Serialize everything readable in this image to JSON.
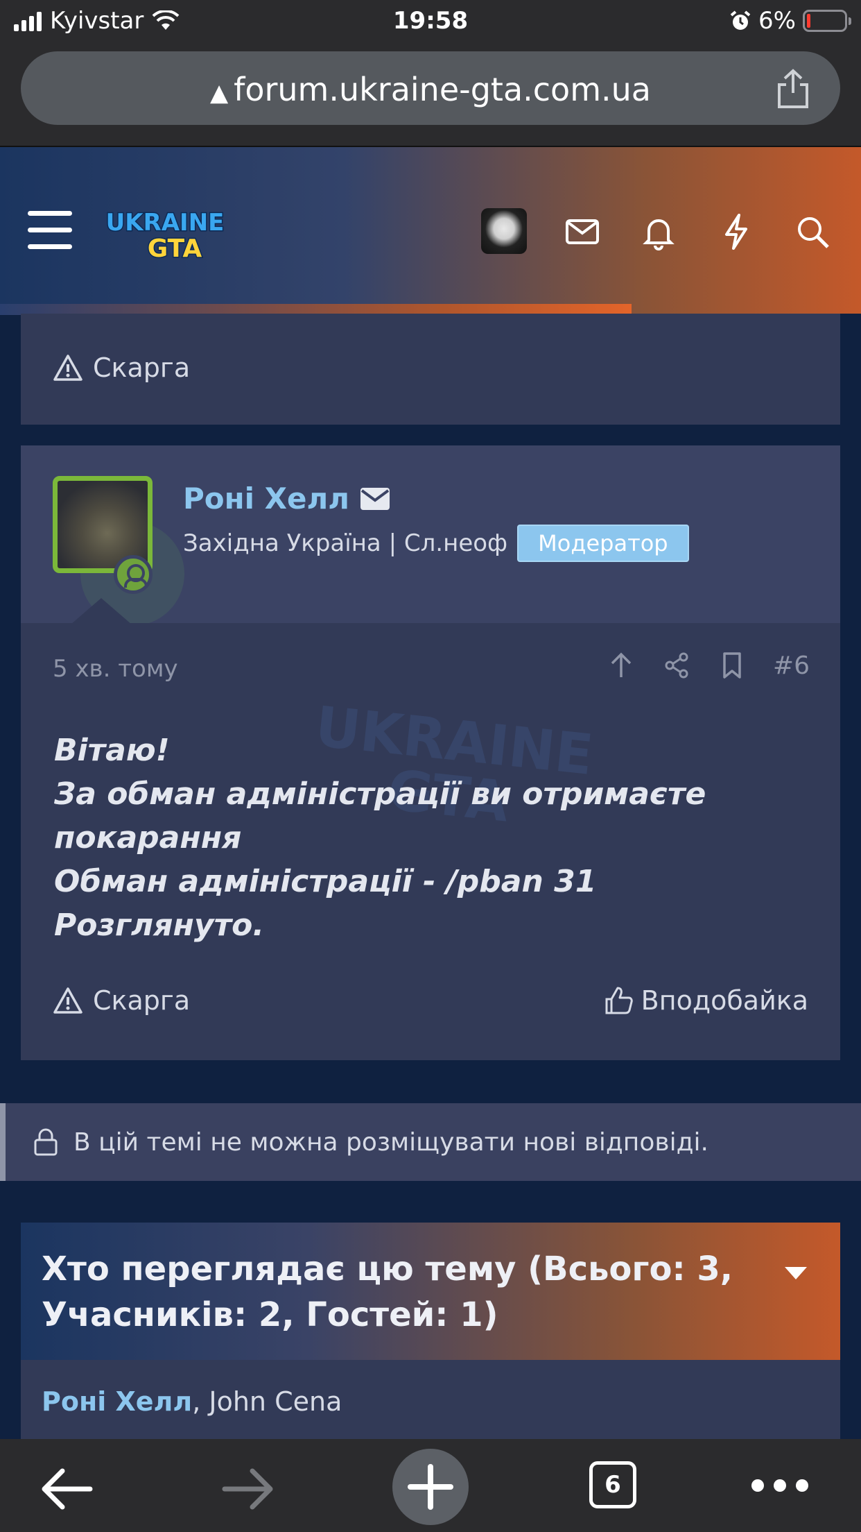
{
  "status_bar": {
    "carrier": "Kyivstar",
    "time": "19:58",
    "battery": "6%"
  },
  "browser": {
    "url": "forum.ukraine-gta.com.ua",
    "tabs_count": "6"
  },
  "site": {
    "logo_text_top": "UKRAINE",
    "logo_text_bottom": "GTA"
  },
  "previous_post": {
    "report_label": "Скарга"
  },
  "post": {
    "author": "Роні Хелл",
    "user_title": "Західна Україна | Сл.неоф",
    "role_badge": "Модератор",
    "time": "5 хв. тому",
    "number": "#6",
    "message_lines": [
      "Вітаю!",
      "За обман адміністрації ви отримаєте",
      "покарання",
      "Обман адміністрації - /pban 31",
      "Розглянуто."
    ],
    "report_label": "Скарга",
    "like_label": "Вподобайка"
  },
  "thread": {
    "locked_notice": "В цій темі не можна розміщувати нові відповіді."
  },
  "viewers": {
    "title": "Хто переглядає цю тему (Всього: 3, Учасників: 2, Гостей: 1)",
    "member1": "Роні Хелл",
    "separator": ", ",
    "member2": "John Cena"
  },
  "colors": {
    "accent_blue": "#8cc6ee",
    "online_green": "#7bb83a",
    "header_orange": "#c4592a"
  }
}
